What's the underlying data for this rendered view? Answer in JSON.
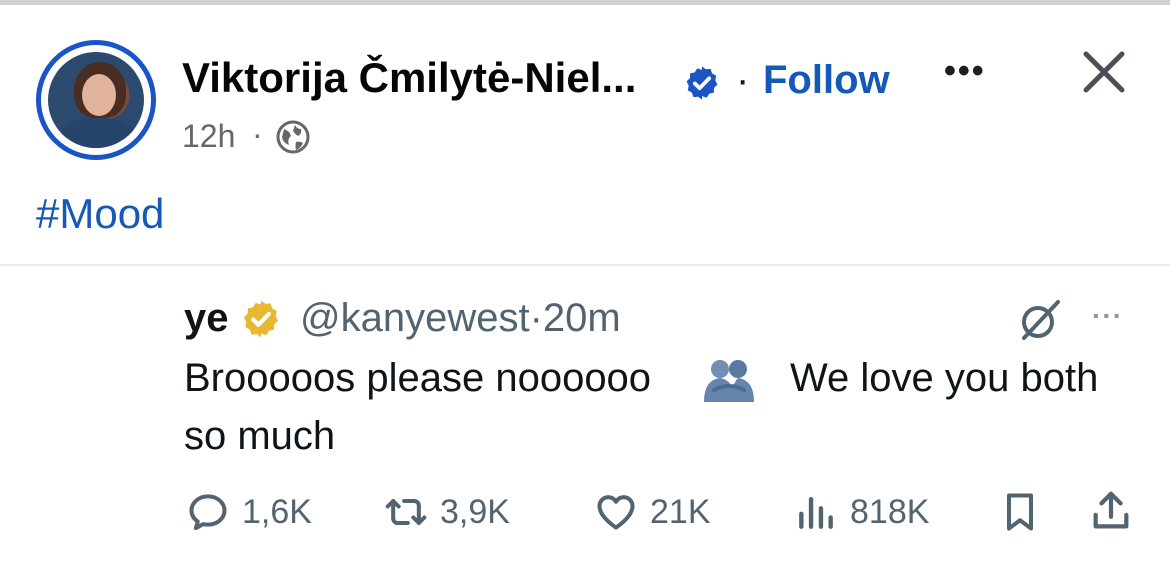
{
  "post": {
    "author": "Viktorija Čmilytė-Niel...",
    "follow_separator": "·",
    "follow_label": "Follow",
    "more_label": "•••",
    "time": "12h",
    "time_separator": "·",
    "hashtag": "#Mood",
    "icons": {
      "verified": "verified-badge-icon",
      "close": "close-icon",
      "audience": "globe-icon"
    },
    "colors": {
      "link": "#1458b8",
      "avatar_ring": "#1a55c6"
    }
  },
  "tweet": {
    "name": "ye",
    "handle_time": "@kanyewest·20m",
    "text_part1": "Brooooos please noooooo",
    "emoji": "people-hugging-emoji",
    "text_part2": "We love you both",
    "text_part3": "so much",
    "more_label": "···",
    "actions": {
      "replies": "1,6K",
      "reposts": "3,9K",
      "likes": "21K",
      "views": "818K"
    },
    "colors": {
      "verified_gold": "#e8b830",
      "muted": "#536471"
    }
  }
}
